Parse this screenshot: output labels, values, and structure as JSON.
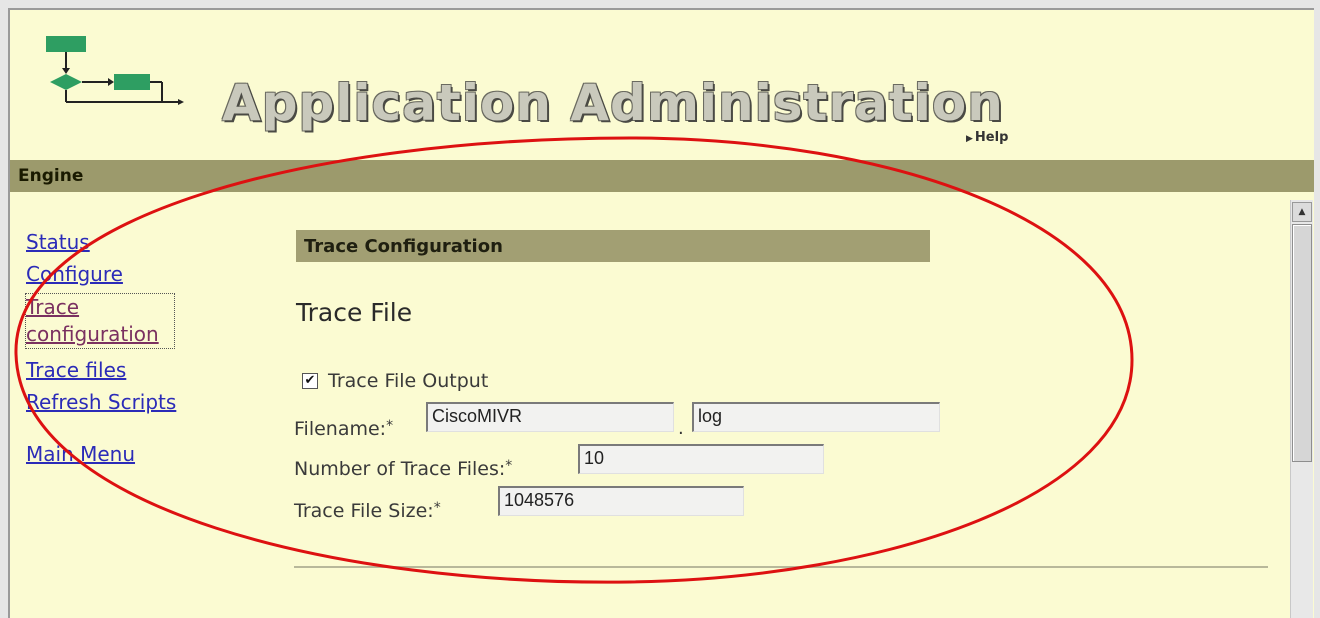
{
  "header": {
    "title": "Application Administration",
    "help_label": "Help"
  },
  "engine_bar": {
    "label": "Engine"
  },
  "nav": {
    "items": [
      {
        "label": "Status"
      },
      {
        "label": "Configure"
      },
      {
        "label": "Trace configuration"
      },
      {
        "label": "Trace files"
      },
      {
        "label": "Refresh Scripts"
      },
      {
        "label": "Main Menu"
      }
    ]
  },
  "content": {
    "section_title": "Trace Configuration",
    "subtitle": "Trace File",
    "trace_output_label": "Trace File Output",
    "trace_output_checked": true,
    "filename_label": "Filename:",
    "filename_value": "CiscoMIVR",
    "filename_ext_value": "log",
    "num_files_label": "Number of Trace Files:",
    "num_files_value": "10",
    "file_size_label": "Trace File Size:",
    "file_size_value": "1048576",
    "required_mark": "*"
  },
  "colors": {
    "background": "#fbfbd2",
    "bar": "#9c9a6c",
    "link": "#2b2bb8",
    "annotation": "#dd1111"
  }
}
